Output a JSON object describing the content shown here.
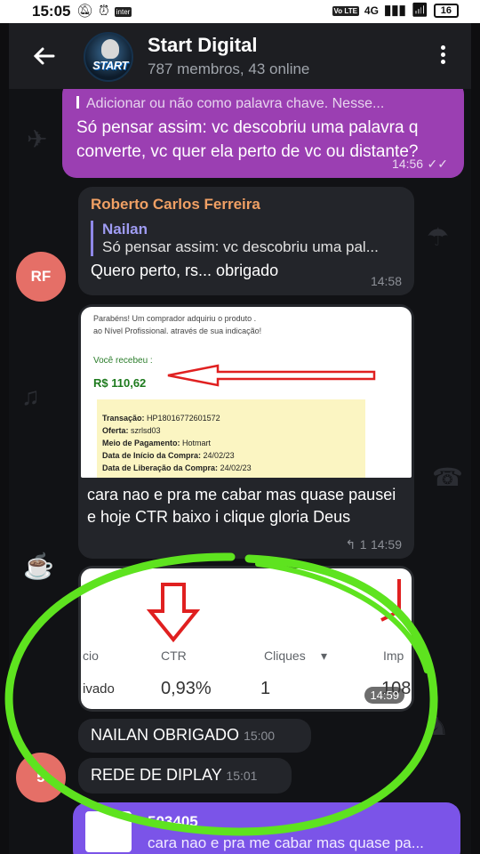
{
  "status": {
    "time": "15:05",
    "network": "4G",
    "battery": "16"
  },
  "header": {
    "title": "Start Digital",
    "subtitle": "787 membros, 43 online",
    "avatar_text": "START"
  },
  "messages": {
    "m1": {
      "clip": "Adicionar ou não como palavra chave. Nesse...",
      "text": "Só pensar assim: vc descobriu uma palavra q converte, vc quer ela perto de vc ou distante?",
      "time": "14:56"
    },
    "m2": {
      "sender": "Roberto Carlos Ferreira",
      "reply_name": "Nailan",
      "reply_text": "Só pensar assim: vc descobriu uma pal...",
      "text": "Quero perto, rs... obrigado",
      "time": "14:58",
      "avatar": "RF"
    },
    "m3": {
      "photo": {
        "line1": "Parabéns! Um comprador adquiriu o produto .",
        "line2": "ao Nível Profissional. através de sua indicação!",
        "received_label": "Você recebeu :",
        "amount": "R$ 110,62",
        "transacao_label": "Transação:",
        "transacao": "HP18016772601572",
        "oferta_label": "Oferta:",
        "oferta": "szrlsd03",
        "pagamento_label": "Meio de Pagamento:",
        "pagamento": "Hotmart",
        "inicio_label": "Data de Início da Compra:",
        "inicio": "24/02/23",
        "liberacao_label": "Data de Liberação da Compra:",
        "liberacao": "24/02/23"
      },
      "text": "cara nao e pra me cabar mas quase pausei e hoje CTR baixo i clique gloria Deus",
      "replies": "1",
      "time": "14:59"
    },
    "m4": {
      "col1": "cio",
      "col2": "CTR",
      "col3": "Cliques",
      "col4": "Imp",
      "val1": "ivado",
      "val2": "0,93%",
      "val3": "1",
      "val4": "108",
      "time": "14:59"
    },
    "m5": {
      "text": "NAILAN OBRIGADO",
      "time": "15:00"
    },
    "m6": {
      "text": "REDE DE DIPLAY",
      "time": "15:01",
      "avatar": "5"
    },
    "m7": {
      "reply_name": "503405",
      "reply_text": "cara nao e pra me cabar mas quase pa..."
    }
  },
  "colors": {
    "outgoing": "#9b3fb2",
    "incoming": "#23252a",
    "highlight": "#5ee31f",
    "avatar": "#e56f67"
  }
}
